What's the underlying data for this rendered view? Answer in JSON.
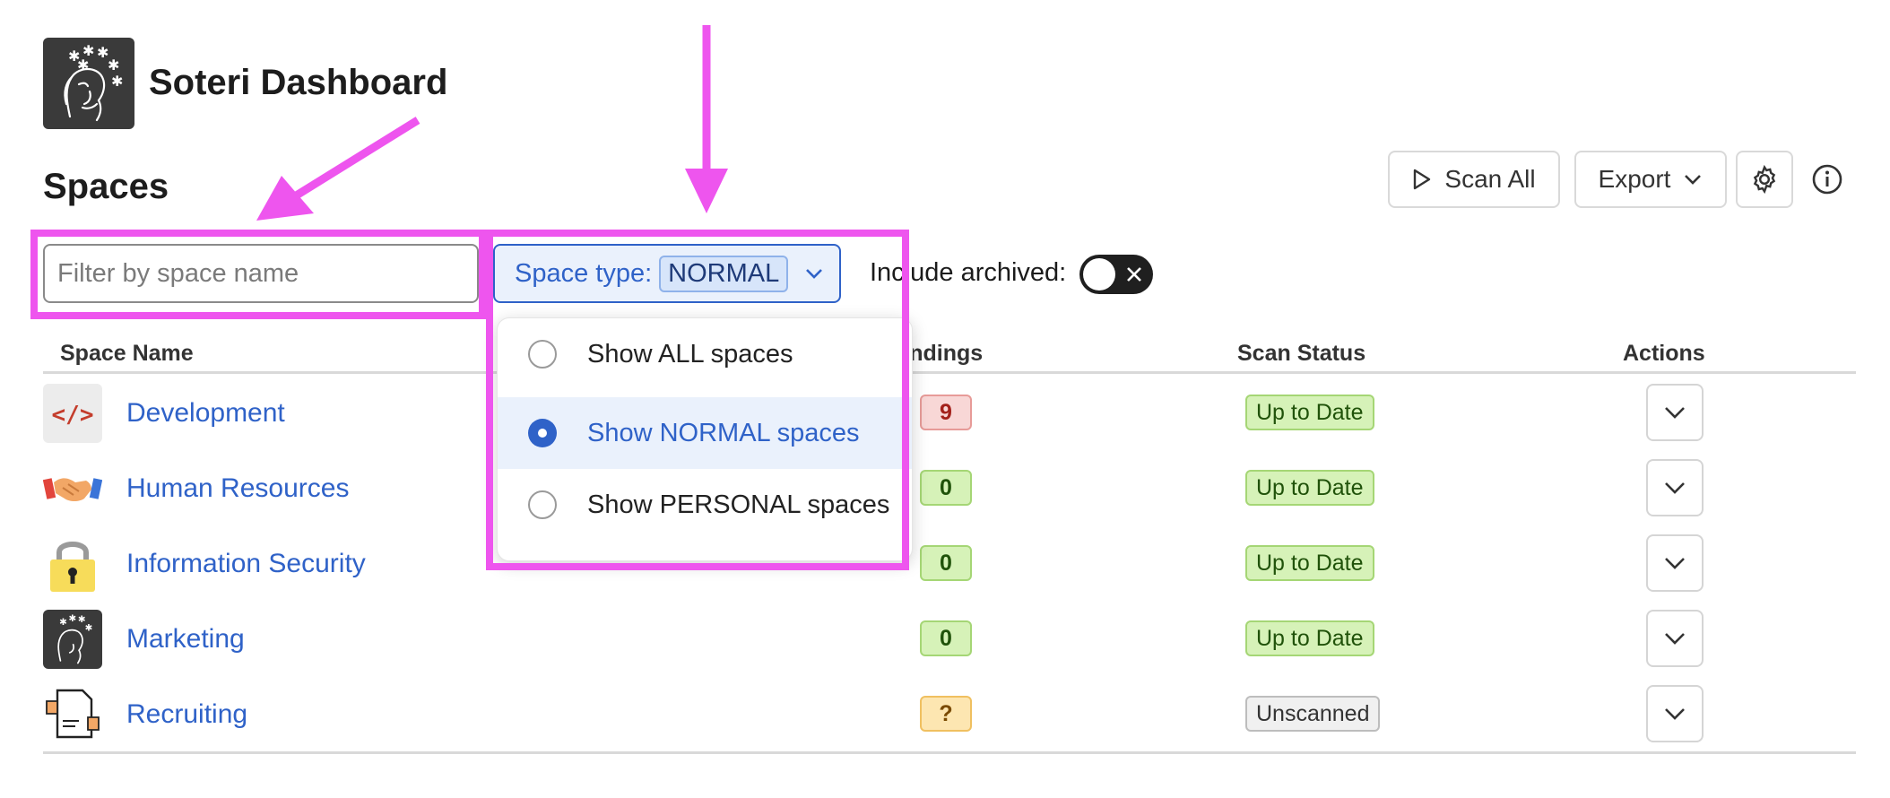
{
  "app": {
    "title": "Soteri Dashboard",
    "logo_icon": "soteri-logo"
  },
  "page": {
    "title": "Spaces"
  },
  "toolbar": {
    "scan_all_label": "Scan All",
    "export_label": "Export"
  },
  "filter": {
    "placeholder": "Filter by space name",
    "value": ""
  },
  "space_type": {
    "label": "Space type:",
    "selected": "NORMAL"
  },
  "archived": {
    "label": "Include archived:",
    "enabled": false
  },
  "table": {
    "headers": {
      "name": "Space Name",
      "findings": "Findings",
      "scan_status": "Scan Status",
      "actions": "Actions"
    },
    "rows": [
      {
        "name": "Development",
        "icon": "code-icon",
        "findings": "9",
        "findings_color": "red",
        "status": "Up to Date"
      },
      {
        "name": "Human Resources",
        "icon": "handshake-icon",
        "findings": "0",
        "findings_color": "green",
        "status": "Up to Date"
      },
      {
        "name": "Information Security",
        "icon": "lock-icon",
        "findings": "0",
        "findings_color": "green",
        "status": "Up to Date"
      },
      {
        "name": "Marketing",
        "icon": "soteri-logo-icon",
        "findings": "0",
        "findings_color": "green",
        "status": "Up to Date"
      },
      {
        "name": "Recruiting",
        "icon": "document-handshake-icon",
        "findings": "?",
        "findings_color": "yellow",
        "status": "Unscanned"
      }
    ]
  },
  "dropdown": {
    "items": [
      {
        "label": "Show ALL spaces",
        "selected": false
      },
      {
        "label": "Show NORMAL spaces",
        "selected": true
      },
      {
        "label": "Show PERSONAL spaces",
        "selected": false
      }
    ]
  },
  "colors": {
    "accent": "#2f62c8",
    "annotation": "#ee55ee"
  }
}
